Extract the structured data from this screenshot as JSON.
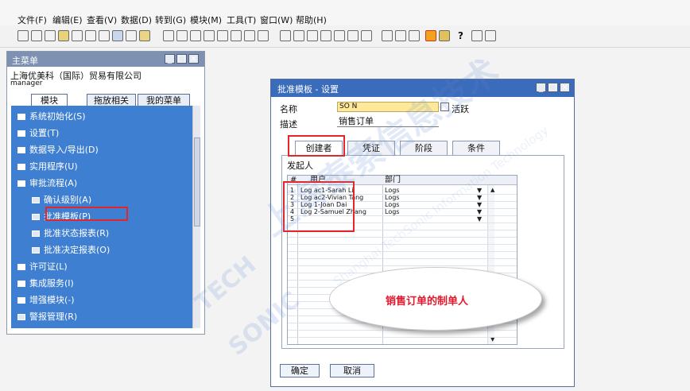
{
  "menubar": [
    "文件(F)",
    "编辑(E)",
    "查看(V)",
    "数据(D)",
    "转到(G)",
    "模块(M)",
    "工具(T)",
    "窗口(W)",
    "帮助(H)"
  ],
  "main_menu": {
    "title": "主菜单",
    "company": "上海优美科（国际）贸易有限公司",
    "user": "manager",
    "tabs": [
      "模块",
      "拖放相关",
      "我的菜单"
    ],
    "items": [
      {
        "label": "系统初始化(S)",
        "level": 1,
        "icon": "folder-icon"
      },
      {
        "label": "设置(T)",
        "level": 1,
        "icon": "folder-icon"
      },
      {
        "label": "数据导入/导出(D)",
        "level": 1,
        "icon": "folder-icon"
      },
      {
        "label": "实用程序(U)",
        "level": 1,
        "icon": "folder-icon"
      },
      {
        "label": "审批流程(A)",
        "level": 1,
        "icon": "folder-open-icon"
      },
      {
        "label": "确认级别(A)",
        "level": 2,
        "icon": "form-icon"
      },
      {
        "label": "批准模板(P)",
        "level": 2,
        "icon": "form-icon"
      },
      {
        "label": "批准状态报表(R)",
        "level": 2,
        "icon": "form-icon"
      },
      {
        "label": "批准决定报表(O)",
        "level": 2,
        "icon": "form-icon"
      },
      {
        "label": "许可证(L)",
        "level": 1,
        "icon": "folder-icon"
      },
      {
        "label": "集成服务(I)",
        "level": 1,
        "icon": "folder-icon"
      },
      {
        "label": "增强模块(-)",
        "level": 1,
        "icon": "folder-icon"
      },
      {
        "label": "警报管理(R)",
        "level": 1,
        "icon": "form-icon"
      }
    ]
  },
  "dialog": {
    "title": "批准模板 - 设置",
    "name_label": "名称",
    "name_value": "SO N",
    "active_label": "活跃",
    "desc_label": "描述",
    "desc_value": "销售订单",
    "tabs": [
      "创建者",
      "凭证",
      "阶段",
      "条件"
    ],
    "section": "发起人",
    "grid_headers": [
      "#",
      "用户",
      "部门"
    ],
    "rows": [
      {
        "num": "1",
        "user": "Log ac1-Sarah Li",
        "dept": "Logs"
      },
      {
        "num": "2",
        "user": "Log ac2-Vivian Tang",
        "dept": "Logs"
      },
      {
        "num": "3",
        "user": "Log 1-Joan Dai",
        "dept": "Logs"
      },
      {
        "num": "4",
        "user": "Log 2-Samuel Zhang",
        "dept": "Logs"
      },
      {
        "num": "5",
        "user": "",
        "dept": ""
      }
    ],
    "ok_label": "确定",
    "cancel_label": "取消"
  },
  "callout": "销售订单的制单人",
  "watermark": {
    "cn": "上海泰索信息技术",
    "en": "Shanghai TechSonic Information Technology",
    "logo_top": "TECH",
    "logo_bottom": "SONIC"
  },
  "colors": {
    "module_list_bg": "#3f7fd1",
    "dialog_title_bg": "#3b6bbb",
    "highlight": "#e4262b",
    "name_field": "#ffe898"
  }
}
